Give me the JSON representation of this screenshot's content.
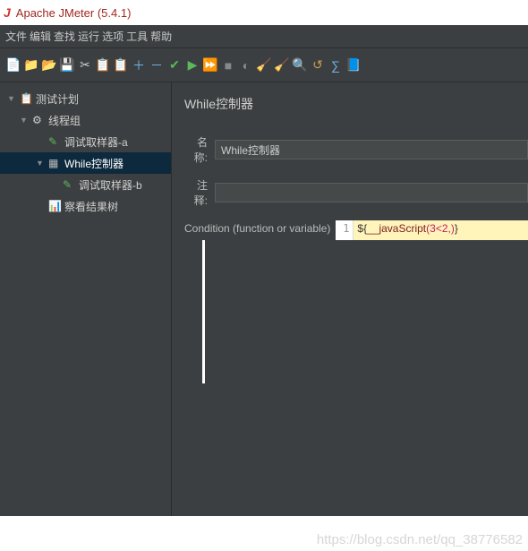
{
  "window": {
    "logo": "J",
    "title": "Apache JMeter (5.4.1)"
  },
  "menu": {
    "items": [
      "文件",
      "编辑",
      "查找",
      "运行",
      "选项",
      "工具",
      "帮助"
    ]
  },
  "toolbar": {
    "icons": [
      {
        "name": "new-icon",
        "glyph": "📄",
        "color": "#e8e8e8"
      },
      {
        "name": "templates-icon",
        "glyph": "📁",
        "color": "#d89b3a"
      },
      {
        "name": "open-icon",
        "glyph": "📂",
        "color": "#d89b3a"
      },
      {
        "name": "save-icon",
        "glyph": "💾",
        "color": "#4a90d9"
      },
      {
        "name": "cut-icon",
        "glyph": "✂",
        "color": "#ccc"
      },
      {
        "name": "copy-icon",
        "glyph": "📋",
        "color": "#d89b3a"
      },
      {
        "name": "paste-icon",
        "glyph": "📋",
        "color": "#8a6d3b"
      },
      {
        "name": "expand-icon",
        "glyph": "＋",
        "color": "#6fb4e8"
      },
      {
        "name": "collapse-icon",
        "glyph": "－",
        "color": "#6fb4e8"
      },
      {
        "name": "toggle-icon",
        "glyph": "✔",
        "color": "#5cb85c"
      },
      {
        "name": "start-icon",
        "glyph": "▶",
        "color": "#5cb85c"
      },
      {
        "name": "start-no-timers-icon",
        "glyph": "⏩",
        "color": "#5cb85c"
      },
      {
        "name": "stop-icon",
        "glyph": "■",
        "color": "#888"
      },
      {
        "name": "shutdown-icon",
        "glyph": "◐",
        "color": "#888"
      },
      {
        "name": "clear-icon",
        "glyph": "🧹",
        "color": "#b89060"
      },
      {
        "name": "clear-all-icon",
        "glyph": "🧹",
        "color": "#8a6530"
      },
      {
        "name": "search-icon",
        "glyph": "🔍",
        "color": "#c9a050"
      },
      {
        "name": "reset-search-icon",
        "glyph": "↺",
        "color": "#c9a050"
      },
      {
        "name": "function-helper-icon",
        "glyph": "∑",
        "color": "#6fb4e8"
      },
      {
        "name": "help-icon",
        "glyph": "📘",
        "color": "#6fb4e8"
      }
    ]
  },
  "tree": {
    "root": {
      "label": "测试计划",
      "arrow": "▼",
      "icon": "📋"
    },
    "threadGroup": {
      "label": "线程组",
      "arrow": "▼",
      "icon": "⚙"
    },
    "items": [
      {
        "name": "sampler-a",
        "label": "调试取样器-a",
        "icon": "✎",
        "icoColor": "#5cb85c"
      },
      {
        "name": "while-controller",
        "label": "While控制器",
        "icon": "▦",
        "icoColor": "#bbb",
        "selected": true,
        "arrow": "▼"
      },
      {
        "name": "sampler-b",
        "label": "调试取样器-b",
        "icon": "✎",
        "icoColor": "#5cb85c",
        "indent": true
      },
      {
        "name": "view-results-tree",
        "label": "察看结果树",
        "icon": "📊",
        "icoColor": "#c060a0"
      }
    ]
  },
  "panel": {
    "title": "While控制器",
    "nameLabel": "名称:",
    "nameValue": "While控制器",
    "commentLabel": "注释:",
    "commentValue": "",
    "condLabel": "Condition (function or variable)",
    "gutter": "1",
    "codePrefix": "${",
    "codeFn": "__javaScript",
    "codeArgs": "(3<2,)",
    "codeSuffix": "}"
  },
  "watermark": "https://blog.csdn.net/qq_38776582"
}
